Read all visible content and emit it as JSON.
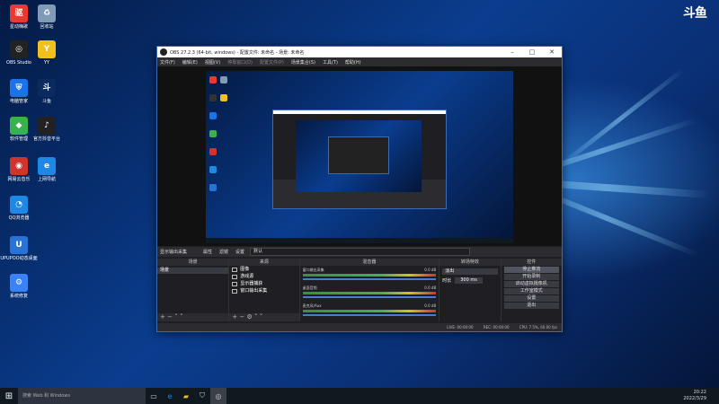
{
  "watermark": "斗鱼",
  "desktop_icons": [
    {
      "label": "星动嗨歌",
      "icon": "xingdong-app-icon",
      "color": "#e83a2e",
      "glyph": "驱"
    },
    {
      "label": "回收站",
      "icon": "recycle-bin-icon",
      "color": "#7f9bb6",
      "glyph": "♻"
    },
    {
      "label": "OBS Studio",
      "icon": "obs-icon",
      "color": "#222222",
      "glyph": "◎"
    },
    {
      "label": "YY",
      "icon": "yy-icon",
      "color": "#f2c01e",
      "glyph": "Y"
    },
    {
      "label": "电脑管家",
      "icon": "pc-manager-icon",
      "color": "#1a73e8",
      "glyph": "⛨"
    },
    {
      "label": "斗鱼",
      "icon": "douyu-icon",
      "color": "#0b2a5e",
      "glyph": "斗"
    },
    {
      "label": "软件管理",
      "icon": "software-manager-icon",
      "color": "#37b24d",
      "glyph": "◆"
    },
    {
      "label": "官方抖音平台",
      "icon": "douyin-platform-icon",
      "color": "#222222",
      "glyph": "♪"
    },
    {
      "label": "网易云音乐",
      "icon": "netease-music-icon",
      "color": "#d0342c",
      "glyph": "◉"
    },
    {
      "label": "上网导航",
      "icon": "ie-icon",
      "color": "#1e88e5",
      "glyph": "e"
    },
    {
      "label": "QQ浏览器",
      "icon": "qq-browser-icon",
      "color": "#1e88e5",
      "glyph": "◔"
    },
    {
      "label": "UPUPOO动态桌面",
      "icon": "upupoo-icon",
      "color": "#2a73d6",
      "glyph": "U"
    },
    {
      "label": "系统修复",
      "icon": "system-repair-icon",
      "color": "#3b82f6",
      "glyph": "⚙"
    }
  ],
  "obs": {
    "title": "OBS 27.2.3 (64-bit, windows) - 配置文件: 未命名 - 场景: 未命名",
    "menu": [
      "文件(F)",
      "编辑(E)",
      "视图(V)",
      "停靠窗口(D)",
      "配置文件(P)",
      "场景集合(S)",
      "工具(T)",
      "帮助(H)"
    ],
    "source_bar": {
      "source": "显示输出采集",
      "props": "属性",
      "filter": "滤镜",
      "settings": "设置",
      "mode": "默认"
    },
    "scenes": {
      "header": "场景",
      "items": [
        "场景"
      ]
    },
    "sources": {
      "header": "来源",
      "items": [
        "图像",
        "游戏源",
        "显示器捕获",
        "窗口输出采集"
      ]
    },
    "mixer": {
      "header": "混音器",
      "channels": [
        {
          "name": "窗口输出采集",
          "db": "0.0 dB"
        },
        {
          "name": "桌面音频",
          "db": "0.0 dB"
        },
        {
          "name": "麦克风/Aux",
          "db": "0.0 dB"
        }
      ]
    },
    "transitions": {
      "header": "转场特效",
      "type": "淡出",
      "duration_label": "时长",
      "duration": "300 ms"
    },
    "controls": {
      "header": "控件",
      "buttons": [
        "停止推流",
        "开始录制",
        "启动虚拟摄像机",
        "工作室模式",
        "设置",
        "退出"
      ]
    },
    "status": {
      "live": "LIVE: 00:00:00",
      "rec": "REC: 00:00:00",
      "cpu": "CPU: 7.5%, 60.00 fps"
    }
  },
  "taskbar": {
    "search_placeholder": "搜索 Web 和 Windows",
    "time": "20:22",
    "date": "2022/3/29"
  }
}
